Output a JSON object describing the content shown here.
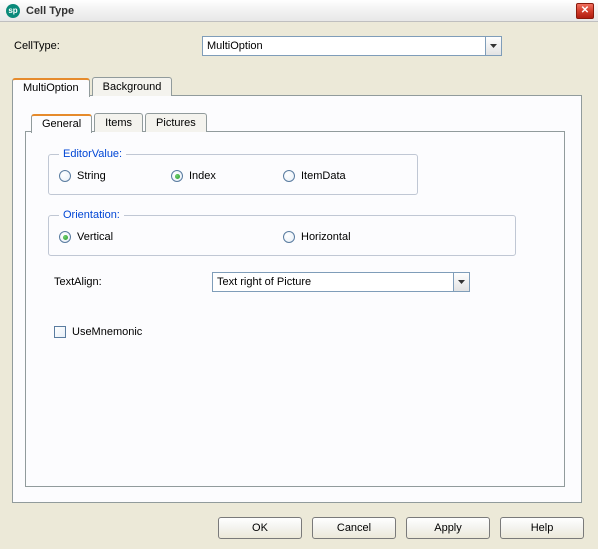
{
  "window": {
    "title": "Cell Type",
    "icon_label": "app-icon",
    "close_glyph": "✕"
  },
  "celltype": {
    "label": "CellType:",
    "value": "MultiOption"
  },
  "outer_tabs": [
    "MultiOption",
    "Background"
  ],
  "inner_tabs": [
    "General",
    "Items",
    "Pictures"
  ],
  "editor_value": {
    "legend": "EditorValue:",
    "options": [
      "String",
      "Index",
      "ItemData"
    ],
    "selected": "Index"
  },
  "orientation": {
    "legend": "Orientation:",
    "options": [
      "Vertical",
      "Horizontal"
    ],
    "selected": "Vertical"
  },
  "textalign": {
    "label": "TextAlign:",
    "value": "Text right of Picture"
  },
  "use_mnemonic": {
    "label": "UseMnemonic",
    "checked": false
  },
  "buttons": {
    "ok": "OK",
    "cancel": "Cancel",
    "apply": "Apply",
    "help": "Help"
  }
}
